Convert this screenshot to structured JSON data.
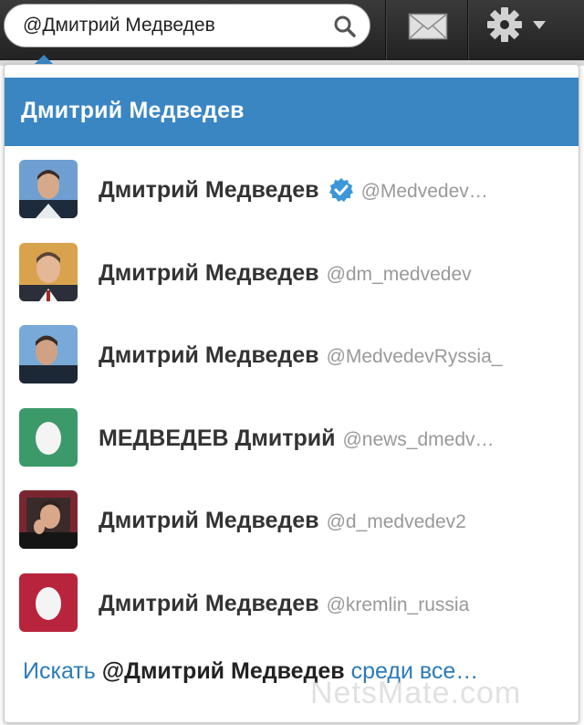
{
  "search": {
    "value": "@Дмитрий Медведев",
    "icon": "search-icon"
  },
  "topbar": {
    "icons": [
      "mail-icon",
      "gear-icon",
      "caret-down-icon"
    ]
  },
  "dropdown": {
    "header": "Дмитрий Медведев",
    "results": [
      {
        "name": "Дмитрий Медведев",
        "handle": "@Medvedev…",
        "verified": true,
        "avatar": "photo"
      },
      {
        "name": "Дмитрий Медведев",
        "handle": "@dm_medvedev",
        "verified": false,
        "avatar": "photo"
      },
      {
        "name": "Дмитрий Медведев",
        "handle": "@MedvedevRyssia_",
        "verified": false,
        "avatar": "photo"
      },
      {
        "name": "МЕДВЕДЕВ Дмитрий",
        "handle": "@news_dmedv…",
        "verified": false,
        "avatar": "egg",
        "egg_color": "#3c9a6a"
      },
      {
        "name": "Дмитрий Медведев",
        "handle": "@d_medvedev2",
        "verified": false,
        "avatar": "photo"
      },
      {
        "name": "Дмитрий Медведев",
        "handle": "@kremlin_russia",
        "verified": false,
        "avatar": "egg",
        "egg_color": "#b8243c"
      }
    ],
    "search_all": {
      "prefix": "Искать",
      "query": "@Дмитрий Медведев",
      "suffix": "среди все…"
    }
  },
  "watermark": "NetsMate.com",
  "colors": {
    "accent": "#3a86c3",
    "link": "#2b7bb9",
    "topbar": "#2a2a2a"
  }
}
